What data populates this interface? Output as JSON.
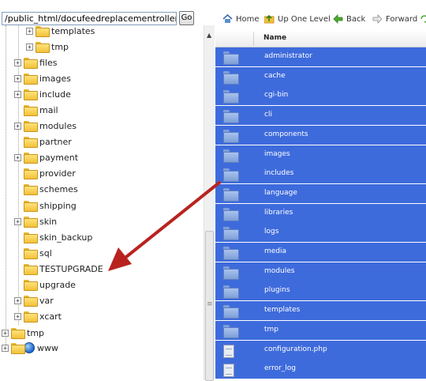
{
  "toolbar": {
    "path_value": "/public_html/docufeedreplacementrollers.",
    "go_label": "Go",
    "home_label": "Home",
    "up_label": "Up One Level",
    "back_label": "Back",
    "forward_label": "Forward"
  },
  "tree": {
    "items": [
      {
        "label": "templates",
        "expand": "+"
      },
      {
        "label": "tmp",
        "expand": "+"
      },
      {
        "label": "files",
        "expand": "+"
      },
      {
        "label": "images",
        "expand": "+"
      },
      {
        "label": "include",
        "expand": "+"
      },
      {
        "label": "mail",
        "expand": ""
      },
      {
        "label": "modules",
        "expand": "+"
      },
      {
        "label": "partner",
        "expand": ""
      },
      {
        "label": "payment",
        "expand": "+"
      },
      {
        "label": "provider",
        "expand": ""
      },
      {
        "label": "schemes",
        "expand": ""
      },
      {
        "label": "shipping",
        "expand": ""
      },
      {
        "label": "skin",
        "expand": "+"
      },
      {
        "label": "skin_backup",
        "expand": ""
      },
      {
        "label": "sql",
        "expand": ""
      },
      {
        "label": "TESTUPGRADE",
        "expand": ""
      },
      {
        "label": "upgrade",
        "expand": ""
      },
      {
        "label": "var",
        "expand": "+"
      },
      {
        "label": "xcart",
        "expand": "+"
      },
      {
        "label": "tmp",
        "expand": "+"
      },
      {
        "label": "www",
        "expand": "+"
      }
    ]
  },
  "list": {
    "name_header": "Name",
    "rows": [
      {
        "name": "administrator",
        "type": "folder"
      },
      {
        "name": "cache",
        "type": "folder"
      },
      {
        "name": "cgi-bin",
        "type": "folder"
      },
      {
        "name": "cli",
        "type": "folder"
      },
      {
        "name": "components",
        "type": "folder"
      },
      {
        "name": "images",
        "type": "folder"
      },
      {
        "name": "includes",
        "type": "folder"
      },
      {
        "name": "language",
        "type": "folder"
      },
      {
        "name": "libraries",
        "type": "folder"
      },
      {
        "name": "logs",
        "type": "folder"
      },
      {
        "name": "media",
        "type": "folder"
      },
      {
        "name": "modules",
        "type": "folder"
      },
      {
        "name": "plugins",
        "type": "folder"
      },
      {
        "name": "templates",
        "type": "folder"
      },
      {
        "name": "tmp",
        "type": "folder"
      },
      {
        "name": "configuration.php",
        "type": "file"
      },
      {
        "name": "error_log",
        "type": "file"
      }
    ]
  },
  "colors": {
    "selection": "#3e6bdc",
    "annotation_arrow": "#b8231f"
  }
}
